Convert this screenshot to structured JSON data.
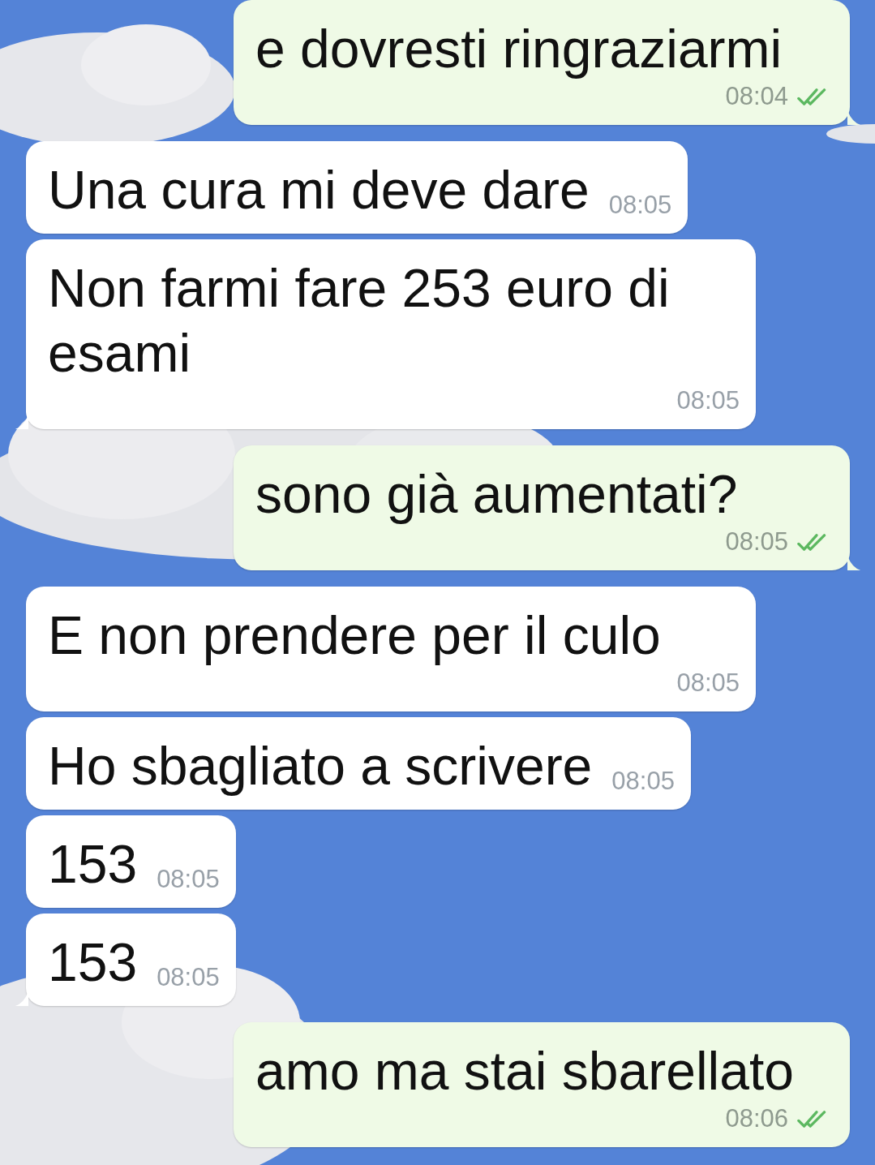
{
  "messages": [
    {
      "kind": "outgoing",
      "text": "e dovresti ringraziarmi",
      "time": "08:04",
      "read": true,
      "tail": true
    },
    {
      "kind": "incoming",
      "text": "Una cura mi deve dare",
      "time": "08:05",
      "tail": false
    },
    {
      "kind": "incoming",
      "text": "Non farmi fare 253 euro di esami",
      "time": "08:05",
      "tail": true
    },
    {
      "kind": "outgoing",
      "text": "sono già aumentati?",
      "time": "08:05",
      "read": true,
      "tail": true
    },
    {
      "kind": "incoming",
      "text": "E non prendere per il culo",
      "time": "08:05",
      "tail": false
    },
    {
      "kind": "incoming",
      "text": "Ho sbagliato a scrivere",
      "time": "08:05",
      "tail": false
    },
    {
      "kind": "incoming",
      "text": "153",
      "time": "08:05",
      "tail": false
    },
    {
      "kind": "incoming",
      "text": "153",
      "time": "08:05",
      "tail": true
    },
    {
      "kind": "outgoing",
      "text": "amo ma stai sbarellato",
      "time": "08:06",
      "read": true,
      "tail": false
    }
  ]
}
